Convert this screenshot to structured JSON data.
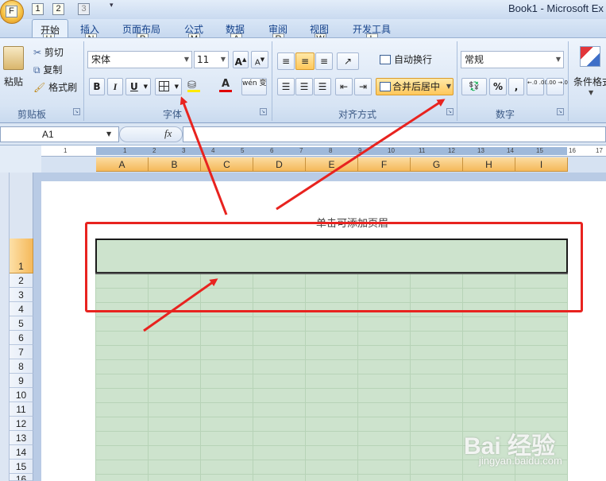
{
  "window": {
    "title": "Book1 - Microsoft Ex"
  },
  "office_button": {
    "keytip": "F"
  },
  "quick_access": [
    {
      "keytip": "1"
    },
    {
      "keytip": "2"
    },
    {
      "keytip": "3"
    }
  ],
  "tabs": [
    {
      "label": "开始",
      "keytip": "H"
    },
    {
      "label": "插入",
      "keytip": "N"
    },
    {
      "label": "页面布局",
      "keytip": "P"
    },
    {
      "label": "公式",
      "keytip": "M"
    },
    {
      "label": "数据",
      "keytip": "A"
    },
    {
      "label": "审阅",
      "keytip": "R"
    },
    {
      "label": "视图",
      "keytip": "W"
    },
    {
      "label": "开发工具",
      "keytip": "L"
    }
  ],
  "clipboard": {
    "paste": "粘贴",
    "cut": "剪切",
    "copy": "复制",
    "format_painter": "格式刷",
    "label": "剪贴板"
  },
  "font": {
    "name": "宋体",
    "size": "11",
    "bold": "B",
    "italic": "I",
    "underline": "U",
    "font_color": "A",
    "phonetic": "wén 变",
    "label": "字体"
  },
  "alignment": {
    "wrap_text": "自动换行",
    "merge_center": "合并后居中",
    "label": "对齐方式"
  },
  "number": {
    "format": "常规",
    "percent": "%",
    "comma": ",",
    "inc_decimal": "←.0 .00",
    "dec_decimal": ".00 →.0",
    "label": "数字"
  },
  "styles": {
    "conditional": "条件格式"
  },
  "formula_bar": {
    "name_box": "A1",
    "fx": "fx"
  },
  "ruler": [
    "1",
    "1",
    "2",
    "3",
    "4",
    "5",
    "6",
    "7",
    "8",
    "9",
    "10",
    "11",
    "12",
    "13",
    "14",
    "15",
    "16",
    "17"
  ],
  "columns": [
    "A",
    "B",
    "C",
    "D",
    "E",
    "F",
    "G",
    "H",
    "I"
  ],
  "rows": [
    "1",
    "2",
    "3",
    "4",
    "5",
    "6",
    "7",
    "8",
    "9",
    "10",
    "11",
    "12",
    "13",
    "14",
    "15",
    "16"
  ],
  "page": {
    "header_hint": "单击可添加页眉"
  },
  "watermark": {
    "brand": "Bai 经验",
    "url": "jingyan.baidu.com"
  },
  "colors": {
    "annotation": "#e8231f",
    "cell_fill": "#cde3cd",
    "header_active": "#f5b95a"
  }
}
